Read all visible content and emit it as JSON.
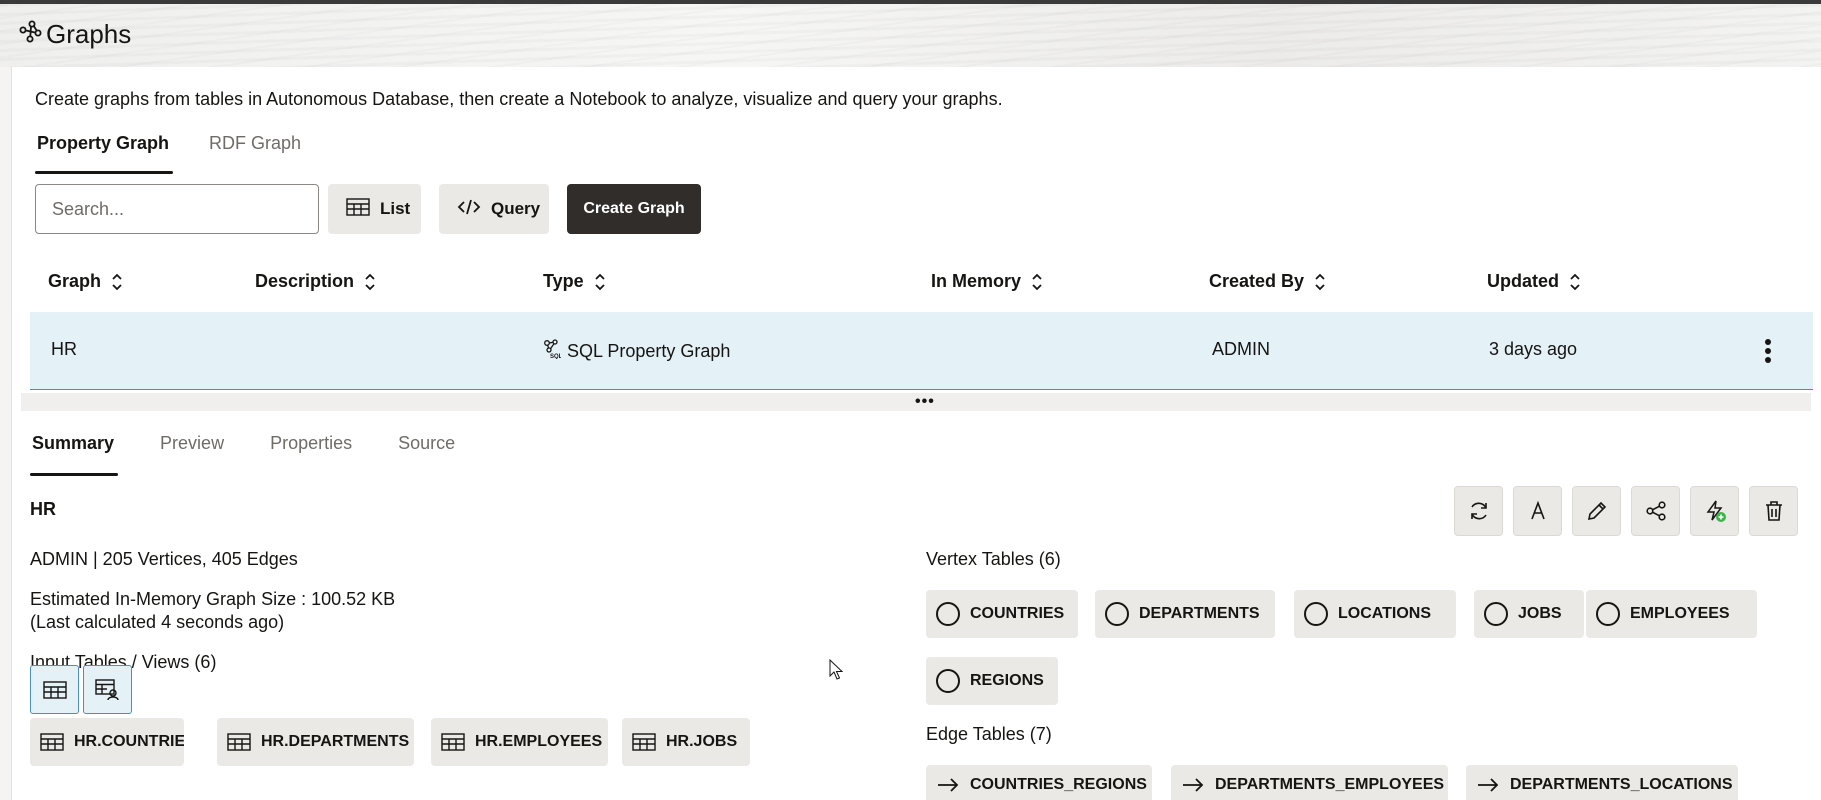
{
  "app": {
    "title": "Graphs"
  },
  "intro": "Create graphs from tables in Autonomous Database, then create a Notebook to analyze, visualize and query your graphs.",
  "top_tabs": [
    {
      "label": "Property Graph",
      "active": true
    },
    {
      "label": "RDF Graph",
      "active": false
    }
  ],
  "toolbar": {
    "search_placeholder": "Search...",
    "list_label": "List",
    "query_label": "Query",
    "create_label": "Create Graph"
  },
  "table": {
    "columns": [
      "Graph",
      "Description",
      "Type",
      "In Memory",
      "Created By",
      "Updated"
    ],
    "rows": [
      {
        "graph": "HR",
        "description": "",
        "type": "SQL Property Graph",
        "in_memory": "",
        "created_by": "ADMIN",
        "updated": "3 days ago"
      }
    ]
  },
  "detail_tabs": [
    {
      "label": "Summary",
      "active": true
    },
    {
      "label": "Preview",
      "active": false
    },
    {
      "label": "Properties",
      "active": false
    },
    {
      "label": "Source",
      "active": false
    }
  ],
  "summary": {
    "name": "HR",
    "stats": "ADMIN | 205 Vertices, 405 Edges",
    "size": "Estimated In-Memory Graph Size : 100.52 KB",
    "calculated": "(Last calculated 4 seconds ago)",
    "inputs_heading": "Input Tables / Views (6)",
    "inputs": [
      "HR.COUNTRIES",
      "HR.DEPARTMENTS",
      "HR.EMPLOYEES",
      "HR.JOBS"
    ],
    "vertex_heading": "Vertex Tables (6)",
    "vertices": [
      "COUNTRIES",
      "DEPARTMENTS",
      "LOCATIONS",
      "JOBS",
      "EMPLOYEES",
      "REGIONS"
    ],
    "edge_heading": "Edge Tables (7)",
    "edges": [
      "COUNTRIES_REGIONS",
      "DEPARTMENTS_EMPLOYEES",
      "DEPARTMENTS_LOCATIONS"
    ]
  },
  "actions": [
    "refresh-icon",
    "font-icon",
    "edit-icon",
    "share-icon",
    "load-memory-icon",
    "delete-icon"
  ],
  "colors": {
    "selected_row": "#e4f1f7",
    "dark_button": "#312d2a",
    "accent_green": "#3bb54a"
  }
}
